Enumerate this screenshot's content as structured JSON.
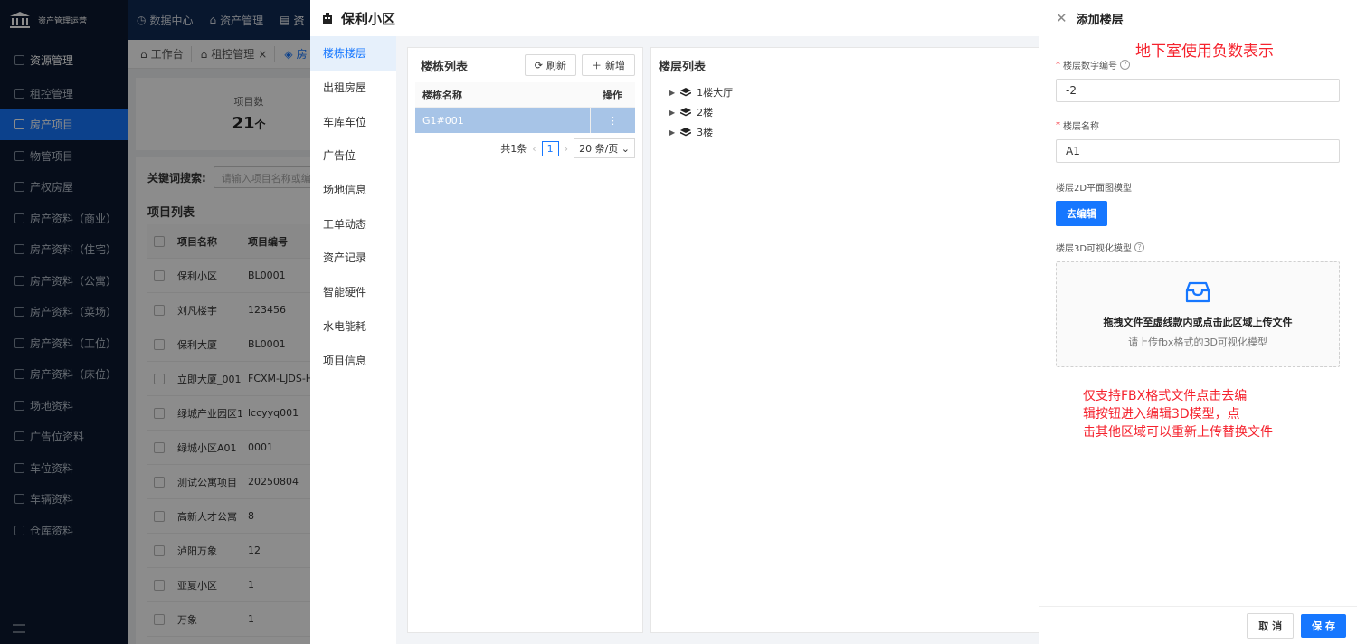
{
  "app": {
    "title": "资产管理运营"
  },
  "topnav": [
    "数据中心",
    "资产管理",
    "资"
  ],
  "tabs": [
    "工作台",
    "租控管理",
    "房"
  ],
  "sidebar": {
    "title": "资源管理",
    "items": [
      "租控管理",
      "房产项目",
      "物管项目",
      "产权房屋",
      "房产资料（商业）",
      "房产资料（住宅）",
      "房产资料（公寓）",
      "房产资料（菜场）",
      "房产资料（工位）",
      "房产资料（床位）",
      "场地资料",
      "广告位资料",
      "车位资料",
      "车辆资料",
      "仓库资料"
    ],
    "active_index": 1
  },
  "stat": {
    "label": "项目数",
    "value": "21",
    "unit": "个"
  },
  "search": {
    "label": "关键词搜索:",
    "placeholder": "请输入项目名称或编号"
  },
  "project_list": {
    "title": "项目列表",
    "columns": [
      "项目名称",
      "项目编号"
    ],
    "rows": [
      [
        "保利小区",
        "BL0001"
      ],
      [
        "刘凡楼宇",
        "123456"
      ],
      [
        "保利大厦",
        "BL0001"
      ],
      [
        "立即大厦_001",
        "FCXM-LJDS-HK"
      ],
      [
        "绿城产业园区1",
        "lccyyq001"
      ],
      [
        "绿城小区A01",
        "0001"
      ],
      [
        "测试公寓项目",
        "20250804"
      ],
      [
        "高新人才公寓",
        "8"
      ],
      [
        "泸阳万象",
        "12"
      ],
      [
        "亚夏小区",
        "1"
      ],
      [
        "万象",
        "1"
      ]
    ]
  },
  "panel": {
    "title": "保利小区",
    "nav": [
      "楼栋楼层",
      "出租房屋",
      "车库车位",
      "广告位",
      "场地信息",
      "工单动态",
      "资产记录",
      "智能硬件",
      "水电能耗",
      "项目信息"
    ],
    "nav_active": 0,
    "building_list": {
      "title": "楼栋列表",
      "refresh": "刷新",
      "add": "新增",
      "col_name": "楼栋名称",
      "col_op": "操作",
      "rows": [
        "G1#001"
      ],
      "pager": {
        "total": "共1条",
        "page": "1",
        "size": "20 条/页"
      }
    },
    "floor_list": {
      "title": "楼层列表",
      "nodes": [
        "1楼大厅",
        "2楼",
        "3楼"
      ]
    }
  },
  "drawer": {
    "title": "添加楼层",
    "annotation_top": "地下室使用负数表示",
    "number_label": "楼层数字编号",
    "number_value": "-2",
    "name_label": "楼层名称",
    "name_value": "A1",
    "model2d_label": "楼层2D平面图模型",
    "edit_button": "去编辑",
    "model3d_label": "楼层3D可视化模型",
    "upload_text": "拖拽文件至虚线款内或点击此区域上传文件",
    "upload_hint": "请上传fbx格式的3D可视化模型",
    "annotation_lines": [
      "仅支持FBX格式文件点击去编",
      "辑按钮进入编辑3D模型，点",
      "击其他区域可以重新上传替换文件"
    ],
    "cancel": "取 消",
    "save": "保 存"
  },
  "colors": {
    "primary": "#1677ff",
    "sidebar_bg": "#0b1930",
    "annotation": "#f5222d"
  }
}
